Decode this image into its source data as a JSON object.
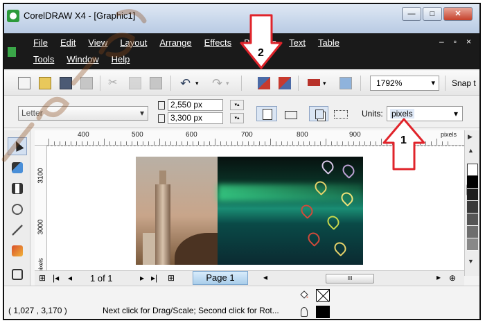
{
  "window": {
    "title": "CorelDRAW X4 - [Graphic1]",
    "minimize": "—",
    "maximize": "□",
    "close": "✕"
  },
  "menu": {
    "row1": [
      "File",
      "Edit",
      "View",
      "Layout",
      "Arrange",
      "Effects",
      "Bitmaps",
      "Text",
      "Table"
    ],
    "row2": [
      "Tools",
      "Window",
      "Help"
    ],
    "mdi_controls": [
      "–",
      "▫",
      "×"
    ]
  },
  "toolbar": {
    "zoom_value": "1792%",
    "snap_label": "Snap t"
  },
  "propertybar": {
    "paper_size": "Letter",
    "width": "2,550 px",
    "height": "3,300 px",
    "units_label": "Units:",
    "units_value": "pixels"
  },
  "ruler": {
    "top_ticks": [
      "400",
      "500",
      "600",
      "700",
      "800",
      "900"
    ],
    "top_unit": "pixels",
    "left_ticks": [
      "3100",
      "3000"
    ],
    "left_unit": "pixels"
  },
  "navigator": {
    "page_count": "1 of 1",
    "page_tab": "Page 1",
    "scroll_grip": "III"
  },
  "status": {
    "coordinates": "( 1,027 , 3,170 )",
    "hint": "Next click for Drag/Scale; Second click for Rot..."
  },
  "callouts": {
    "one": "1",
    "two": "2"
  },
  "colors": {
    "menubar": "#1a1a1a",
    "callout_red": "#e0242b",
    "page_tab": "#a9cdea"
  }
}
